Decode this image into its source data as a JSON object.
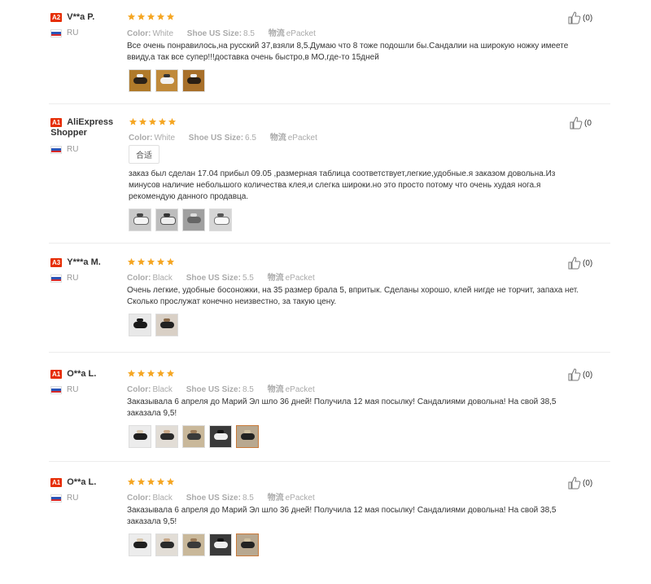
{
  "labels": {
    "color": "Color:",
    "shoe_size": "Shoe US Size:",
    "shipping": "物流",
    "helpful_count": "(0)",
    "helpful_count_truncated": "(0"
  },
  "reviews": [
    {
      "badge": "A2",
      "name": "V**a P.",
      "country": "RU",
      "color": "White",
      "size": "8.5",
      "shipping": "ePacket",
      "text": "Все очень понравилось,на русский 37,взяли 8,5.Думаю что 8 тоже подошли бы.Сандалии на широкую ножку имеете ввиду,а так все супер!!!доставка очень быстро,в МО,где-то 15дней",
      "photos": 3
    },
    {
      "badge": "A1",
      "name": "AliExpress Shopper",
      "country": "RU",
      "color": "White",
      "size": "6.5",
      "shipping": "ePacket",
      "tag": "合适",
      "text": "заказ был сделан 17.04 прибыл 09.05 ,размерная таблица соответствует,легкие,удобные.я заказом довольна.Из минусов наличие небольшого количества клея,и слегка широки.но это просто потому что очень худая нога.я рекомендую данного продавца.",
      "photos": 4
    },
    {
      "badge": "A3",
      "name": "Y***a M.",
      "country": "RU",
      "color": "Black",
      "size": "5.5",
      "shipping": "ePacket",
      "text": "Очень легкие, удобные босоножки, на 35 размер брала 5, впритык. Сделаны хорошо, клей нигде не торчит, запаха нет. Сколько прослужат конечно неизвестно, за такую цену.",
      "photos": 2
    },
    {
      "badge": "A1",
      "name": "O**a L.",
      "country": "RU",
      "color": "Black",
      "size": "8.5",
      "shipping": "ePacket",
      "text": "Заказывала 6 апреля до Марий Эл шло 36 дней! Получила 12 мая посылку! Сандалиями довольна! На свой 38,5 заказала 9,5!",
      "photos": 5
    },
    {
      "badge": "A1",
      "name": "O**a L.",
      "country": "RU",
      "color": "Black",
      "size": "8.5",
      "shipping": "ePacket",
      "text": "Заказывала 6 апреля до Марий Эл шло 36 дней! Получила 12 мая посылку! Сандалиями довольна! На свой 38,5 заказала 9,5!",
      "photos": 5
    }
  ],
  "colors": {
    "badge": "#e62e04",
    "star": "#f5a623",
    "muted": "#aaaaaa"
  }
}
